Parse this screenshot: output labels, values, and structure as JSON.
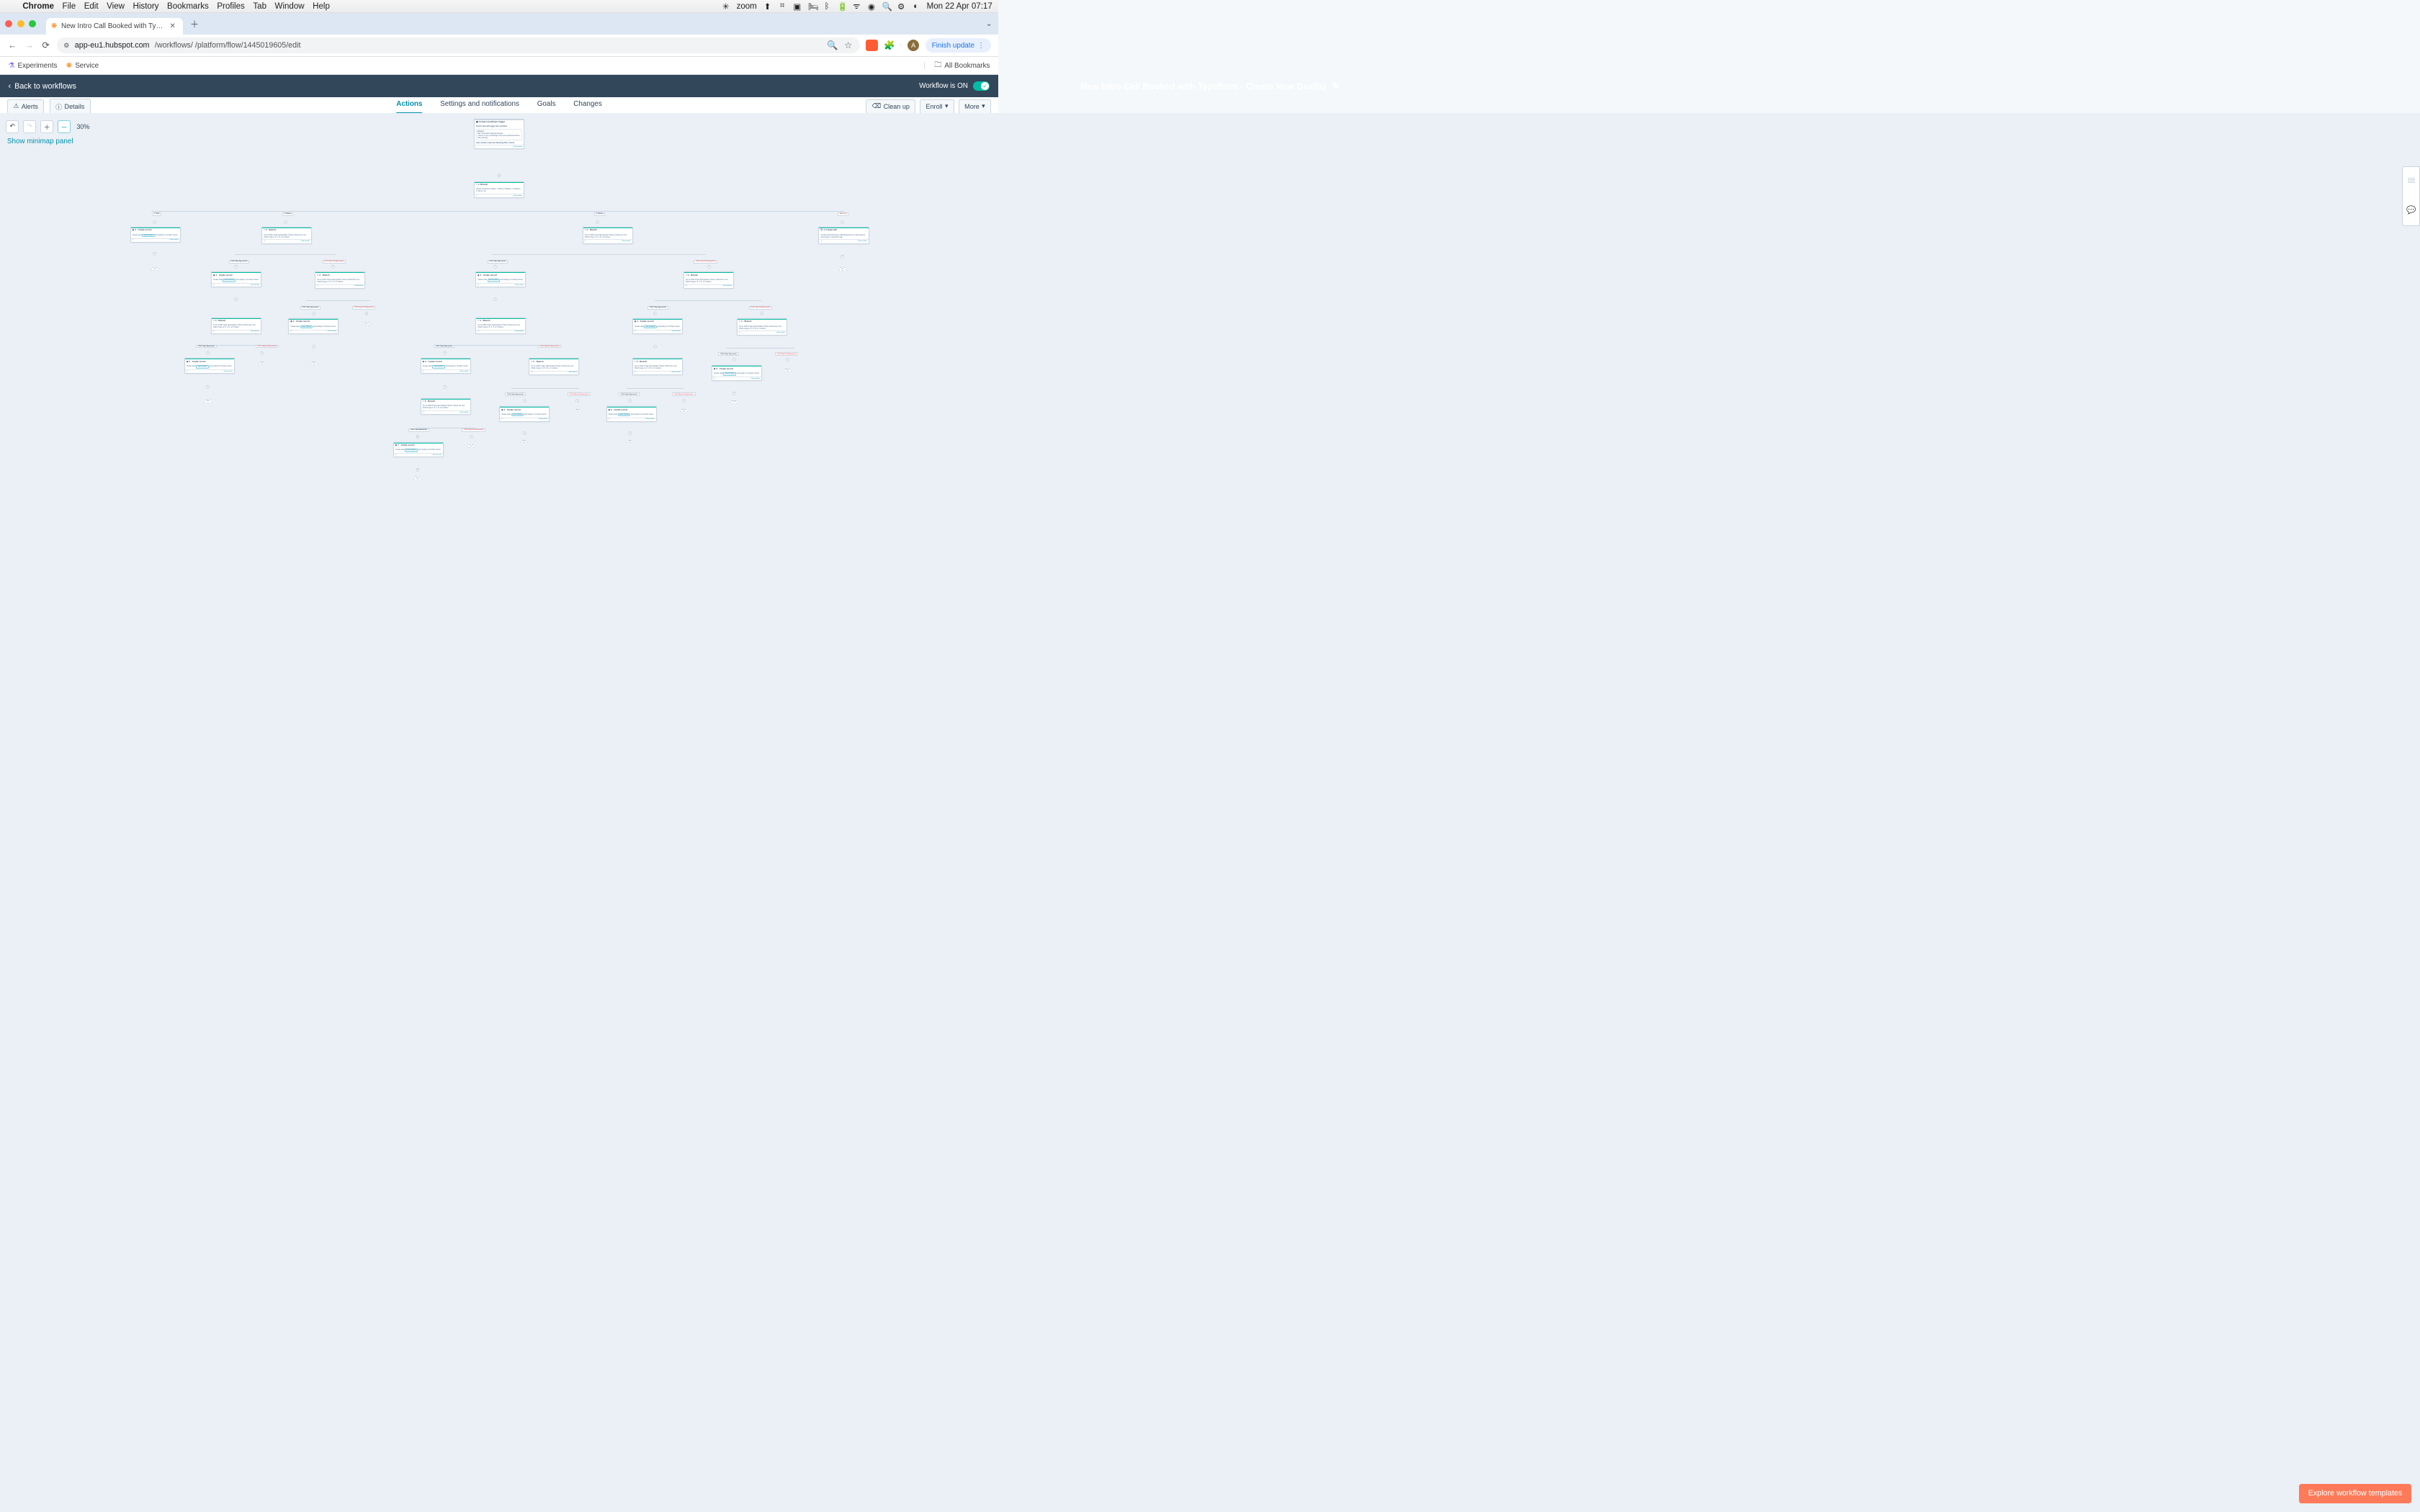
{
  "mac": {
    "apple": "",
    "app": "Chrome",
    "menus": [
      "File",
      "Edit",
      "View",
      "History",
      "Bookmarks",
      "Profiles",
      "Tab",
      "Window",
      "Help"
    ],
    "zoom": "zoom",
    "clock": "Mon 22 Apr  07:17"
  },
  "chrome": {
    "tab_title": "New Intro Call Booked with Ty…",
    "url_host": "app-eu1.hubspot.com",
    "url_path": "/workflows/            /platform/flow/1445019605/edit",
    "finish": "Finish update",
    "bm_experiments": "Experiments",
    "bm_service": "Service",
    "bm_all": "All Bookmarks",
    "avatar": "A"
  },
  "hs": {
    "back": "Back to workflows",
    "title": "New Intro Call Booked with Typeform - Create New Deal(s)",
    "workflow_on": "Workflow is ON",
    "alerts": "Alerts",
    "details": "Details",
    "tab_actions": "Actions",
    "tab_settings": "Settings and notifications",
    "tab_goals": "Goals",
    "tab_changes": "Changes",
    "cleanup": "Clean up",
    "enroll": "Enroll",
    "more": "More",
    "zoom_pct": "30%",
    "minimap": "Show minimap panel",
    "explore": "Explore workflow templates"
  },
  "trigger": {
    "title": "Contact enrollment trigger",
    "desc": "Events that will trigger this workflow",
    "group": "Group 1",
    "line1": "Has completed: Meeting booked",
    "line2": "• Name is any of Meetings Link (new-admissions/intro-call-meeting)",
    "and": "And contacts meet the following filter criteria",
    "show": "+ Show details"
  },
  "branch1": {
    "hdr": "1. Branch",
    "desc": "Check enrollment criteria: 1 Child, 2 Children, 3 Children, or None met",
    "b1": "1 Child",
    "b2": "2 Children",
    "b3": "3 Children",
    "b4": "None met"
  },
  "create": {
    "hdr_n": ". Create record",
    "desc": "Create deal  Sales Pipeline  and assign to Contact owner",
    "show": "+ Show details",
    "pill": "Sales Pipeline"
  },
  "branch_child": {
    "hdr_n": ". Branch",
    "desc2": "Go to Child 2 Age Appropriate if these criteria are met: Child 2 Age is 3, 4, 5, or 6 others",
    "desc3": "Go to Child 3 Age Appropriate if these criteria are met: Child 3 Age is 3, 4, 5, or 6 others",
    "desc4": "Go to Child 4 Age Appropriate if these criteria are met: Child 4 Age is 4, 5, 11, or 4 others",
    "desc5": "Go to Child 5 Age Appropriate if these criteria are met: Child 5 Age is 3, 4, 5, or 6 others",
    "desc6": "Go to Child 6 Age Appropriate if these criteria are met: Child 6 Age is 3, 4, 5, or 4 others"
  },
  "labels": {
    "c2ok": "Child 2 Age Appropriate",
    "c2no": "Child 2 Age Not Appropriate",
    "c3ok": "Child 3 Age Appropriate",
    "c3no": "Child 3 Age Not Appropriate",
    "c4ok": "Child 4 Age Appropriate",
    "c4no": "Child 4 Age Not Appropriate",
    "c5ok": "Child 5 Age Appropriate",
    "c5no": "Child 5 Age Not Appropriate",
    "c6ok": "Child 6 Age Appropriate",
    "c6no": "Child 6 Age Not Appropriate"
  },
  "none": {
    "hdr": "4. Create task",
    "desc": "Create task Admissions Call Booked but no deal present and assign to Amanda Tully"
  },
  "end": "END"
}
